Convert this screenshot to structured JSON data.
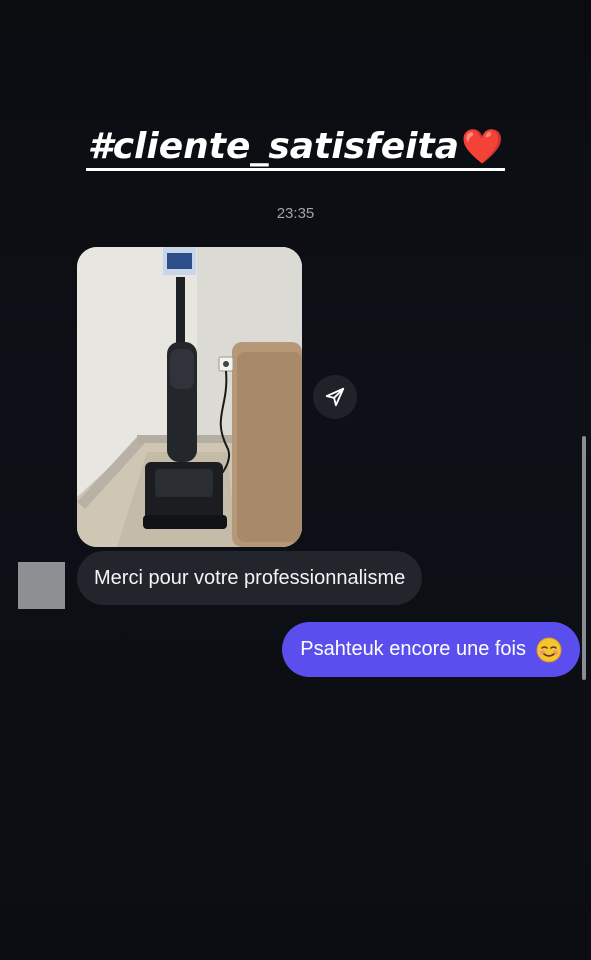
{
  "story": {
    "caption": "#cliente_satisfeita",
    "caption_emoji": "❤️"
  },
  "chat": {
    "timestamp": "23:35",
    "messages": [
      {
        "type": "image",
        "sender": "them",
        "description_icon": "photo-vacuum-cleaner"
      },
      {
        "type": "text",
        "sender": "them",
        "text": "Merci pour votre professionnalisme"
      },
      {
        "type": "text",
        "sender": "me",
        "text": "Psahteuk encore une fois",
        "emoji": "☺️"
      }
    ]
  },
  "colors": {
    "background": "#0b0d12",
    "incoming_bubble": "#23252c",
    "outgoing_bubble": "#5a4fee",
    "timestamp": "#9ea3ad"
  },
  "icons": {
    "share": "send-arrow-icon"
  }
}
